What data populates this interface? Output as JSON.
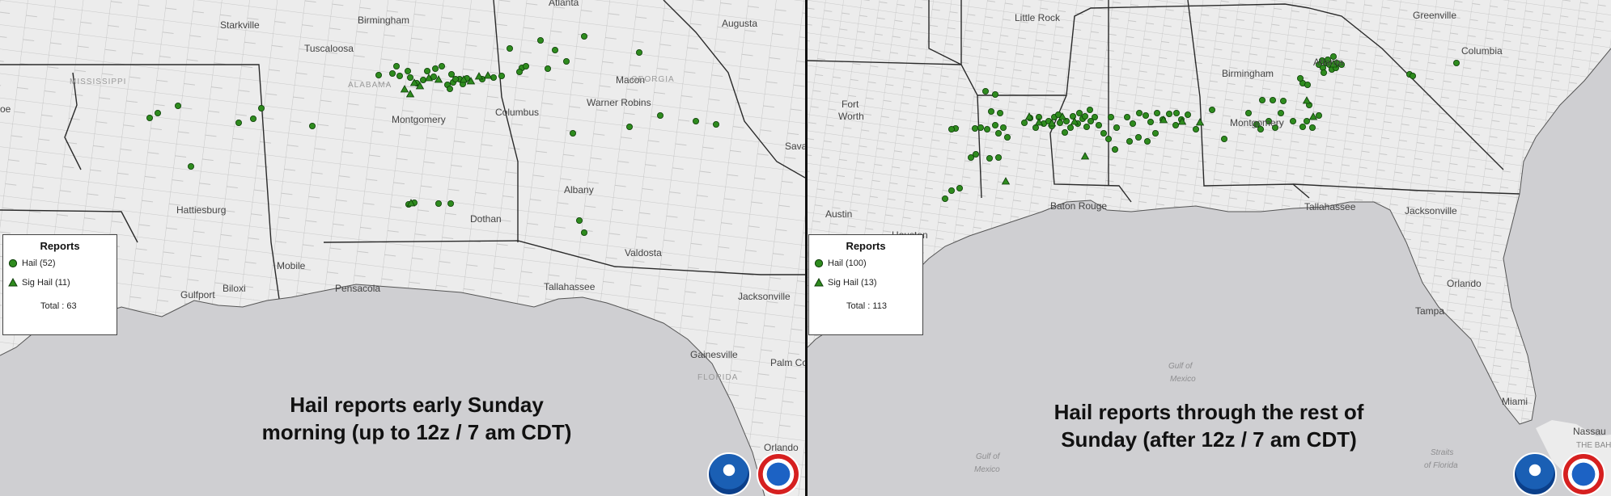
{
  "left_panel": {
    "caption_line1": "Hail reports early Sunday",
    "caption_line2": "morning (up to 12z / 7 am CDT)",
    "legend": {
      "title": "Reports",
      "hail_label": "Hail (52)",
      "sig_label": "Sig Hail (11)",
      "total_label": "Total : 63"
    },
    "cities": [
      "Starkville",
      "Birmingham",
      "Tuscaloosa",
      "Augusta",
      "Macon",
      "Montgomery",
      "Columbus",
      "Warner Robins",
      "Hattiesburg",
      "Albany",
      "Dothan",
      "Mobile",
      "Biloxi",
      "Gulfport",
      "Pensacola",
      "Tallahassee",
      "Valdosta",
      "Jacksonville",
      "Gainesville",
      "Palm Co",
      "Orlando",
      "Sava",
      "oe",
      "Atlanta"
    ],
    "states": [
      "MISSISSIPPI",
      "ALABAMA",
      "GEORGIA",
      "FLORIDA"
    ]
  },
  "right_panel": {
    "caption_line1": "Hail reports through the rest of",
    "caption_line2": "Sunday (after 12z / 7 am CDT)",
    "legend": {
      "title": "Reports",
      "hail_label": "Hail (100)",
      "sig_label": "Sig Hail (13)",
      "total_label": "Total : 113"
    },
    "cities": [
      "Little Rock",
      "Greenville",
      "Atlanta",
      "Columbia",
      "Fort",
      "Worth",
      "Birmingham",
      "Montgomery",
      "Baton Rouge",
      "Austin",
      "Houston",
      "Tallahassee",
      "Jacksonville",
      "Orlando",
      "Tampa",
      "Miami",
      "Nassau",
      "THE BAH"
    ],
    "water": [
      "Gulf of",
      "Mexico",
      "Gulf of",
      "Mexico",
      "Straits",
      "of Florida"
    ]
  },
  "colors": {
    "hail": "#2e8b1e",
    "land": "#ececec",
    "water": "#cfcfd2",
    "county_line": "#b8b8b8",
    "state_line": "#2a2a2a"
  },
  "icons": [
    "noaa-logo-icon",
    "nws-logo-icon",
    "hail-dot-icon",
    "sig-hail-triangle-icon"
  ]
}
